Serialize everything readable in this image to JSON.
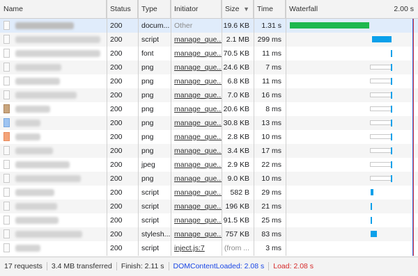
{
  "columns": {
    "name": "Name",
    "status": "Status",
    "type": "Type",
    "initiator": "Initiator",
    "size": "Size",
    "time": "Time",
    "waterfall": "Waterfall",
    "waterfall_scale": "2.00 s",
    "size_sort_icon": "triangle-down-icon"
  },
  "requests": [
    {
      "status": "200",
      "type": "docum...",
      "initiator": "Other",
      "size": "19.6 KB",
      "time": "1.31 s",
      "icon": "document-icon",
      "bar_color": "#1eb84e"
    },
    {
      "status": "200",
      "type": "script",
      "initiator": "manage_que...",
      "size": "2.1 MB",
      "time": "299 ms",
      "icon": "document-icon",
      "bar_color": "#0ba0ea"
    },
    {
      "status": "200",
      "type": "font",
      "initiator": "manage_que...",
      "size": "70.5 KB",
      "time": "11 ms",
      "icon": "document-icon",
      "bar_color": "#0ba0ea"
    },
    {
      "status": "200",
      "type": "png",
      "initiator": "manage_que...",
      "size": "24.6 KB",
      "time": "7 ms",
      "icon": "document-icon",
      "bar_color": "#0ba0ea"
    },
    {
      "status": "200",
      "type": "png",
      "initiator": "manage_que...",
      "size": "6.8 KB",
      "time": "11 ms",
      "icon": "document-icon",
      "bar_color": "#0ba0ea"
    },
    {
      "status": "200",
      "type": "png",
      "initiator": "manage_que...",
      "size": "7.0 KB",
      "time": "16 ms",
      "icon": "document-icon",
      "bar_color": "#0ba0ea"
    },
    {
      "status": "200",
      "type": "png",
      "initiator": "manage_que...",
      "size": "20.6 KB",
      "time": "8 ms",
      "icon": "image-icon",
      "bar_color": "#0ba0ea"
    },
    {
      "status": "200",
      "type": "png",
      "initiator": "manage_que...",
      "size": "30.8 KB",
      "time": "13 ms",
      "icon": "image-icon",
      "bar_color": "#0ba0ea"
    },
    {
      "status": "200",
      "type": "png",
      "initiator": "manage_que...",
      "size": "2.8 KB",
      "time": "10 ms",
      "icon": "image-icon",
      "bar_color": "#0ba0ea"
    },
    {
      "status": "200",
      "type": "png",
      "initiator": "manage_que...",
      "size": "3.4 KB",
      "time": "17 ms",
      "icon": "document-icon",
      "bar_color": "#0ba0ea"
    },
    {
      "status": "200",
      "type": "jpeg",
      "initiator": "manage_que...",
      "size": "2.9 KB",
      "time": "22 ms",
      "icon": "document-icon",
      "bar_color": "#0ba0ea"
    },
    {
      "status": "200",
      "type": "png",
      "initiator": "manage_que...",
      "size": "9.0 KB",
      "time": "10 ms",
      "icon": "document-icon",
      "bar_color": "#0ba0ea"
    },
    {
      "status": "200",
      "type": "script",
      "initiator": "manage_que...",
      "size": "582 B",
      "time": "29 ms",
      "icon": "document-icon",
      "bar_color": "#0ba0ea"
    },
    {
      "status": "200",
      "type": "script",
      "initiator": "manage_que...",
      "size": "196 KB",
      "time": "21 ms",
      "icon": "document-icon",
      "bar_color": "#0ba0ea"
    },
    {
      "status": "200",
      "type": "script",
      "initiator": "manage_que...",
      "size": "91.5 KB",
      "time": "25 ms",
      "icon": "document-icon",
      "bar_color": "#0ba0ea"
    },
    {
      "status": "200",
      "type": "stylesh...",
      "initiator": "manage_que...",
      "size": "757 KB",
      "time": "83 ms",
      "icon": "document-icon",
      "bar_color": "#0ba0ea"
    },
    {
      "status": "200",
      "type": "script",
      "initiator": "inject.js:7",
      "size": "(from ...",
      "time": "3 ms",
      "icon": "document-icon",
      "bar_color": "#0ba0ea"
    }
  ],
  "footer": {
    "requests": "17 requests",
    "transferred": "3.4 MB transferred",
    "finish": "Finish: 2.11 s",
    "dom_content_loaded": "DOMContentLoaded: 2.08 s",
    "load": "Load: 2.08 s"
  },
  "colors": {
    "dom_content_loaded": "#1a47e5",
    "load": "#d62a2a",
    "document_bar": "#1eb84e",
    "resource_bar": "#0ba0ea"
  }
}
